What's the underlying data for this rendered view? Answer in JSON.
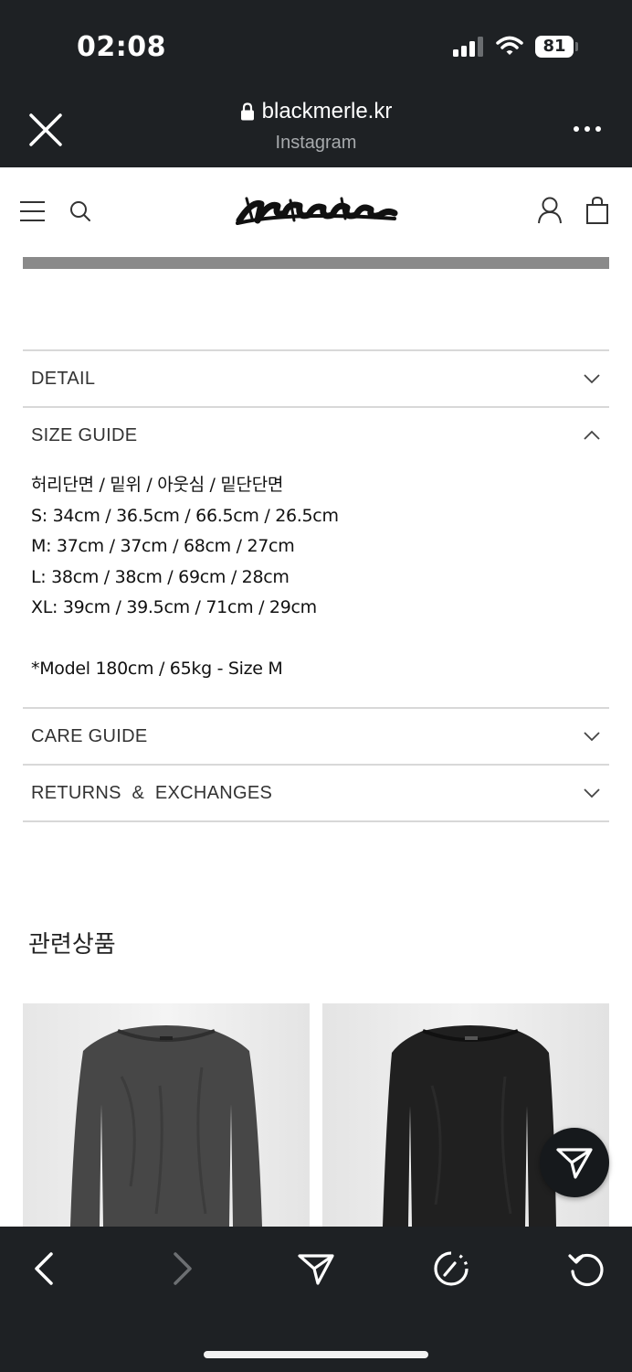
{
  "status_bar": {
    "time": "02:08",
    "battery": "81"
  },
  "browser_header": {
    "url": "blackmerle.kr",
    "source": "Instagram"
  },
  "shop_header": {
    "logo_text": "blackmerle"
  },
  "accordion": [
    {
      "title": "DETAIL",
      "expanded": false
    },
    {
      "title": "SIZE GUIDE",
      "expanded": true,
      "lines": [
        "허리단면 / 밑위 / 아웃심 / 밑단단면",
        "S: 34cm / 36.5cm / 66.5cm / 26.5cm",
        "M: 37cm / 37cm / 68cm / 27cm",
        "L: 38cm / 38cm / 69cm / 28cm",
        "XL: 39cm / 39.5cm / 71cm / 29cm"
      ],
      "note": "*Model 180cm / 65kg - Size M"
    },
    {
      "title": "CARE GUIDE",
      "expanded": false
    },
    {
      "title": "RETURNS  &  EXCHANGES",
      "expanded": false
    }
  ],
  "related": {
    "title": "관련상품"
  },
  "icons": {
    "close": "close-icon",
    "lock": "lock-icon",
    "more": "more-icon",
    "menu": "hamburger-icon",
    "search": "search-icon",
    "user": "user-icon",
    "bag": "shopping-bag-icon",
    "share": "share-icon",
    "back": "back-icon",
    "forward": "forward-icon",
    "speed": "speed-icon",
    "refresh": "refresh-icon"
  },
  "colors": {
    "dark_chrome": "#1e2124",
    "divider": "#d8d8d8",
    "gray_bar": "#8a8a8a"
  }
}
